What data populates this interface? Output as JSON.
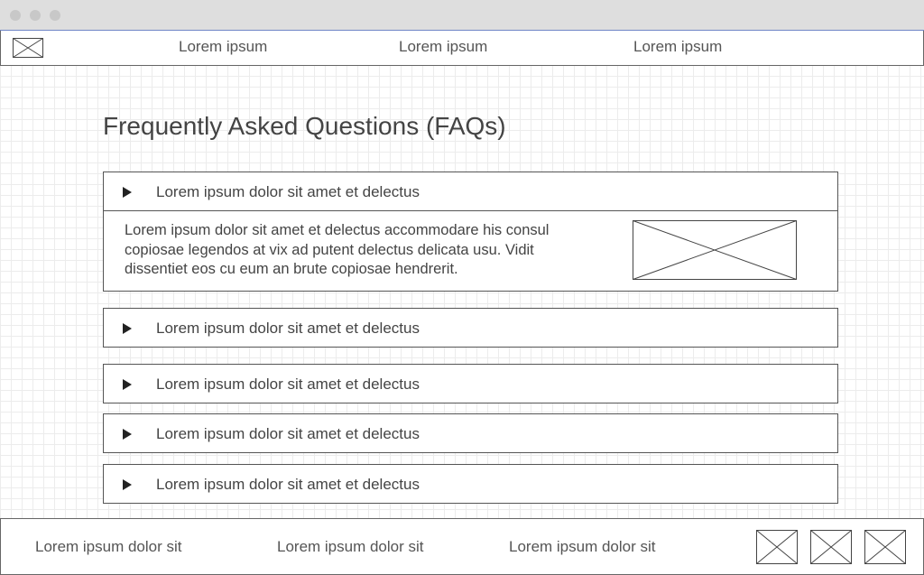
{
  "nav": {
    "links": [
      "Lorem ipsum",
      "Lorem ipsum",
      "Lorem ipsum"
    ]
  },
  "main": {
    "title": "Frequently Asked Questions (FAQs)",
    "faqs": [
      {
        "question": "Lorem ipsum dolor sit amet et delectus",
        "answer": "Lorem ipsum dolor sit amet et delectus accommodare his consul copiosae legendos at vix ad putent delectus delicata usu. Vidit dissentiet eos cu eum an brute copiosae hendrerit.",
        "expanded": true
      },
      {
        "question": "Lorem ipsum dolor sit amet et delectus",
        "expanded": false
      },
      {
        "question": "Lorem ipsum dolor sit amet et delectus",
        "expanded": false
      },
      {
        "question": "Lorem ipsum dolor sit amet et delectus",
        "expanded": false
      },
      {
        "question": "Lorem ipsum dolor sit amet et delectus",
        "expanded": false
      }
    ]
  },
  "footer": {
    "links": [
      "Lorem ipsum dolor sit",
      "Lorem ipsum dolor sit",
      "Lorem ipsum dolor sit"
    ]
  },
  "colors": {
    "titlebar": "#dedede",
    "accent": "#6f86c6",
    "text": "#444444",
    "border": "#555555"
  }
}
